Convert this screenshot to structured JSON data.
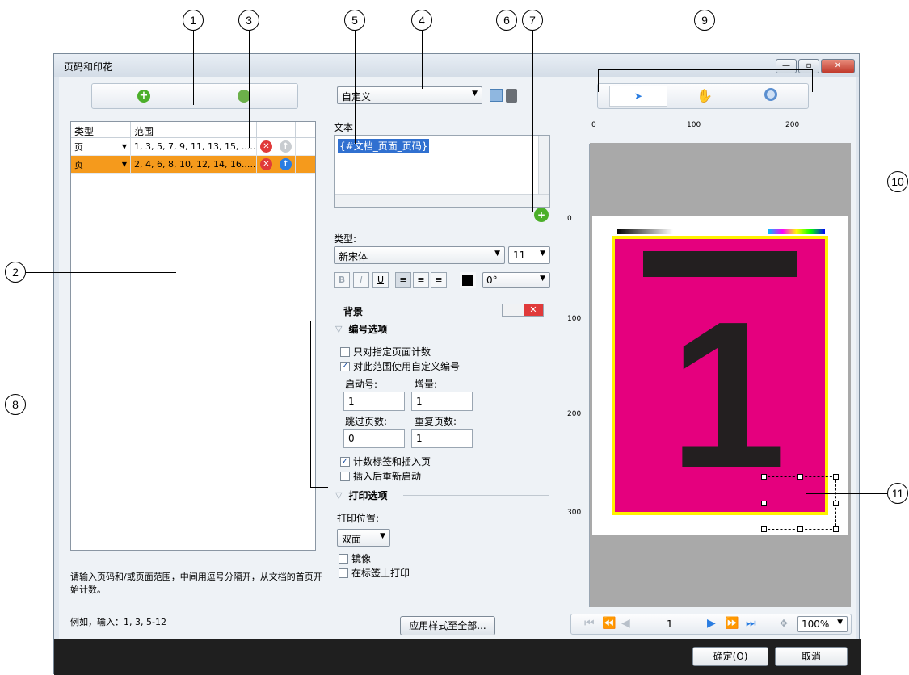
{
  "window": {
    "title": "页码和印花",
    "buttons": {
      "minimize": "—",
      "maximize": "▫",
      "close": "✕"
    }
  },
  "callouts": [
    "1",
    "2",
    "3",
    "4",
    "5",
    "6",
    "7",
    "8",
    "9",
    "10",
    "11"
  ],
  "left_panel": {
    "columns": [
      "类型",
      "范围"
    ],
    "rows": [
      {
        "type": "页",
        "range": "1, 3, 5, 7, 9, 11, 13, 15, ...",
        "more": "...",
        "selected": false
      },
      {
        "type": "页",
        "range": "2, 4, 6, 8, 10, 12, 14, 16...",
        "more": "...",
        "selected": true
      }
    ],
    "hint": "请输入页码和/或页面范围，中间用逗号分隔开，从文档的首页开始计数。",
    "example": "例如，输入：1, 3, 5-12"
  },
  "middle_panel": {
    "preset": "自定义",
    "text_label": "文本",
    "text_value": "{#文档_页面_页码}",
    "type_label": "类型:",
    "font": "新宋体",
    "font_size": "11",
    "format_buttons": [
      "B",
      "I",
      "U"
    ],
    "align_buttons": [
      "≡",
      "≡",
      "≡"
    ],
    "rotation": "0°",
    "background_label": "背景",
    "numbering_section": "编号选项",
    "only_count_specified": "只对指定页面计数",
    "use_custom_numbering": "对此范围使用自定义编号",
    "start_label": "启动号:",
    "start_value": "1",
    "increment_label": "增量:",
    "increment_value": "1",
    "skip_label": "跳过页数:",
    "skip_value": "0",
    "repeat_label": "重复页数:",
    "repeat_value": "1",
    "count_tabs": "计数标签和插入页",
    "restart_after_insert": "插入后重新启动",
    "print_section": "打印选项",
    "print_position_label": "打印位置:",
    "print_position": "双面",
    "mirror": "镜像",
    "print_on_tabs": "在标签上打印",
    "apply_all": "应用样式至全部..."
  },
  "preview": {
    "ruler_top": [
      "0",
      "100",
      "200"
    ],
    "ruler_left": [
      "0",
      "100",
      "200",
      "300"
    ],
    "page_number": "1",
    "zoom": "100%",
    "current_page": "1"
  },
  "footer": {
    "ok": "确定(O)",
    "cancel": "取消"
  },
  "colors": {
    "accent": "#f59a1c",
    "magenta": "#e5007e",
    "yellow": "#fff200",
    "blue": "#2a7de1"
  }
}
